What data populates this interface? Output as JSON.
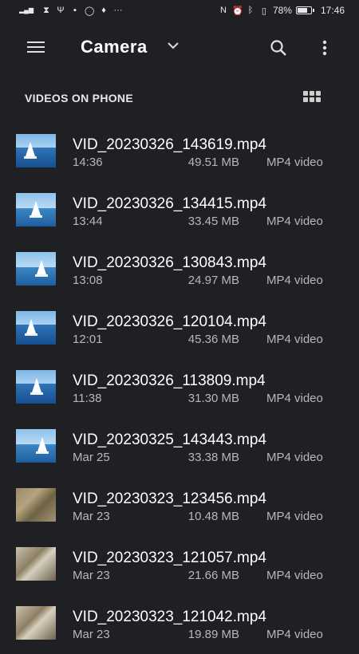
{
  "status_bar": {
    "signal_text": "4G⁺┃┃",
    "battery_percent": "78%",
    "battery_level": 0.78,
    "time": "17:46"
  },
  "app_bar": {
    "title": "Camera"
  },
  "section": {
    "title": "VIDEOS ON PHONE"
  },
  "videos": [
    {
      "name": "VID_20230326_143619.mp4",
      "time": "14:36",
      "size": "49.51 MB",
      "type": "MP4 video",
      "thumb": "sea"
    },
    {
      "name": "VID_20230326_134415.mp4",
      "time": "13:44",
      "size": "33.45 MB",
      "type": "MP4 video",
      "thumb": "sea2"
    },
    {
      "name": "VID_20230326_130843.mp4",
      "time": "13:08",
      "size": "24.97 MB",
      "type": "MP4 video",
      "thumb": "sea2"
    },
    {
      "name": "VID_20230326_120104.mp4",
      "time": "12:01",
      "size": "45.36 MB",
      "type": "MP4 video",
      "thumb": "sea"
    },
    {
      "name": "VID_20230326_113809.mp4",
      "time": "11:38",
      "size": "31.30 MB",
      "type": "MP4 video",
      "thumb": "sea"
    },
    {
      "name": "VID_20230325_143443.mp4",
      "time": "Mar 25",
      "size": "33.38 MB",
      "type": "MP4 video",
      "thumb": "sea2"
    },
    {
      "name": "VID_20230323_123456.mp4",
      "time": "Mar 23",
      "size": "10.48 MB",
      "type": "MP4 video",
      "thumb": "ground"
    },
    {
      "name": "VID_20230323_121057.mp4",
      "time": "Mar 23",
      "size": "21.66 MB",
      "type": "MP4 video",
      "thumb": "ground2"
    },
    {
      "name": "VID_20230323_121042.mp4",
      "time": "Mar 23",
      "size": "19.89 MB",
      "type": "MP4 video",
      "thumb": "ground2"
    }
  ]
}
